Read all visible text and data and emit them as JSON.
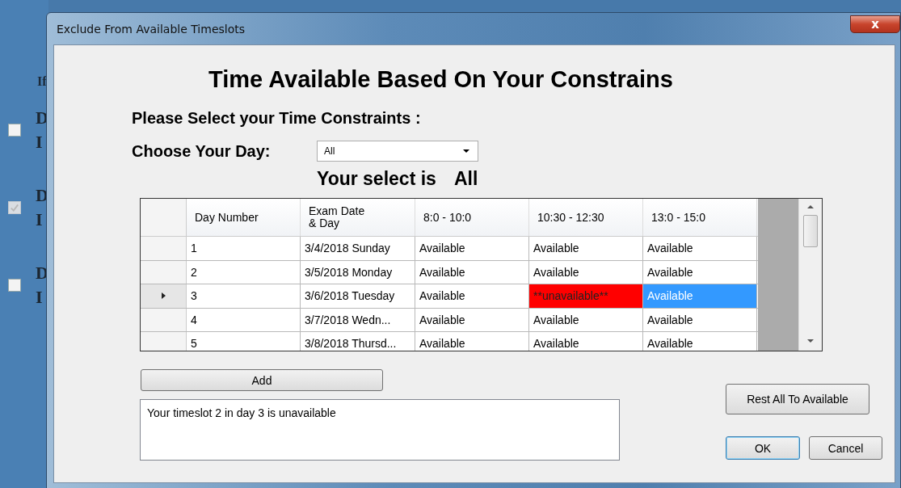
{
  "background": {
    "label": "If",
    "options": [
      {
        "line_1": "D",
        "line_2": "I",
        "checked": false,
        "disabled": false
      },
      {
        "line_1": "D",
        "line_2": "I",
        "checked": true,
        "disabled": true
      },
      {
        "line_1": "D",
        "line_2": "I",
        "checked": false,
        "disabled": false
      }
    ]
  },
  "window": {
    "title": "Exclude From Available Timeslots",
    "close": "x"
  },
  "heading": "Time Available Based On Your Constrains",
  "prompt": "Please Select your Time Constraints :",
  "day_label": "Choose Your Day:",
  "day_select": {
    "value": "All"
  },
  "selection_label": "Your select is",
  "selection_value": "All",
  "table": {
    "columns": [
      "Day Number",
      "Exam Date & Day",
      "8:0 - 10:0",
      "10:30 - 12:30",
      "13:0 - 15:0"
    ],
    "rows": [
      {
        "current": false,
        "day": "1",
        "date": "3/4/2018 Sunday",
        "slots": [
          {
            "text": "Available",
            "unavailable": false,
            "selected": false
          },
          {
            "text": "Available",
            "unavailable": false,
            "selected": false
          },
          {
            "text": "Available",
            "unavailable": false,
            "selected": false
          }
        ]
      },
      {
        "current": false,
        "day": "2",
        "date": "3/5/2018 Monday",
        "slots": [
          {
            "text": "Available",
            "unavailable": false,
            "selected": false
          },
          {
            "text": "Available",
            "unavailable": false,
            "selected": false
          },
          {
            "text": "Available",
            "unavailable": false,
            "selected": false
          }
        ]
      },
      {
        "current": true,
        "day": "3",
        "date": "3/6/2018 Tuesday",
        "slots": [
          {
            "text": "Available",
            "unavailable": false,
            "selected": false
          },
          {
            "text": "**unavailable**",
            "unavailable": true,
            "selected": false
          },
          {
            "text": "Available",
            "unavailable": false,
            "selected": true
          }
        ]
      },
      {
        "current": false,
        "day": "4",
        "date": "3/7/2018 Wedn...",
        "slots": [
          {
            "text": "Available",
            "unavailable": false,
            "selected": false
          },
          {
            "text": "Available",
            "unavailable": false,
            "selected": false
          },
          {
            "text": "Available",
            "unavailable": false,
            "selected": false
          }
        ]
      },
      {
        "current": false,
        "day": "5",
        "date": "3/8/2018 Thursd...",
        "slots": [
          {
            "text": "Available",
            "unavailable": false,
            "selected": false
          },
          {
            "text": "Available",
            "unavailable": false,
            "selected": false
          },
          {
            "text": "Available",
            "unavailable": false,
            "selected": false
          }
        ]
      }
    ]
  },
  "add_button": "Add",
  "message": "Your timeslot 2 in day 3 is unavailable",
  "reset_button": "Rest All To Available",
  "ok_button": "OK",
  "cancel_button": "Cancel"
}
